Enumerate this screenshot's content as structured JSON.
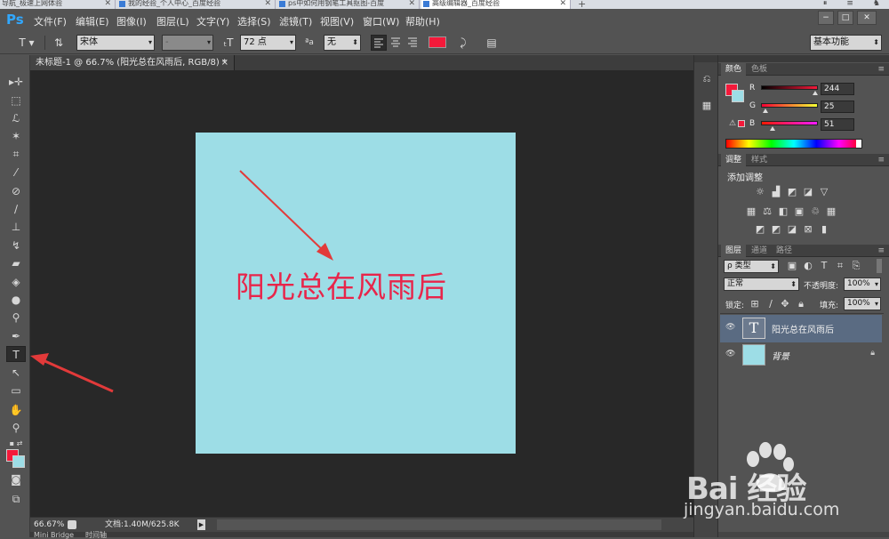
{
  "browser_tabs": [
    {
      "label": "导航_极速上网体验",
      "active": false
    },
    {
      "label": "我的经验_个人中心_百度经验",
      "active": false
    },
    {
      "label": "ps中如何用钢笔工具抠图-百度",
      "active": false
    },
    {
      "label": "高级编辑器_百度经验",
      "active": true
    }
  ],
  "browser_new_tab": "+",
  "app": {
    "logo": "Ps"
  },
  "menu": [
    {
      "label": "文件(F)"
    },
    {
      "label": "编辑(E)"
    },
    {
      "label": "图像(I)"
    },
    {
      "label": "图层(L)"
    },
    {
      "label": "文字(Y)"
    },
    {
      "label": "选择(S)"
    },
    {
      "label": "滤镜(T)"
    },
    {
      "label": "视图(V)"
    },
    {
      "label": "窗口(W)"
    },
    {
      "label": "帮助(H)"
    }
  ],
  "window_controls": {
    "minimize": "−",
    "restore": "□",
    "close": "✕"
  },
  "options": {
    "font_family": "宋体",
    "font_style": "-",
    "font_size": "72 点",
    "antialias": "无",
    "workspace": "基本功能",
    "text_color": "#f4193a"
  },
  "document": {
    "tab_title": "未标题-1 @ 66.7% (阳光总在风雨后, RGB/8) *",
    "canvas_color": "#9ddde6",
    "canvas_text": "阳光总在风雨后",
    "canvas_text_color": "#e8254a"
  },
  "status": {
    "zoom": "66.67%",
    "doc_size": "文档:1.40M/625.8K"
  },
  "bottom_tabs": [
    "Mini Bridge",
    "时间轴"
  ],
  "color_panel": {
    "tabs": [
      "颜色",
      "色板"
    ],
    "r_label": "R",
    "g_label": "G",
    "b_label": "B",
    "r": "244",
    "g": "25",
    "b": "51",
    "fg": "#f4193a",
    "bg": "#9ddde6"
  },
  "adjust_panel": {
    "tabs": [
      "调整",
      "样式"
    ],
    "title": "添加调整"
  },
  "layers_panel": {
    "tabs": [
      "图层",
      "通道",
      "路径"
    ],
    "filter": "ρ 类型",
    "blend_mode": "正常",
    "opacity_label": "不透明度:",
    "opacity": "100%",
    "lock_label": "锁定:",
    "fill_label": "填充:",
    "fill": "100%",
    "layers": [
      {
        "name": "阳光总在风雨后",
        "type": "text",
        "selected": true
      },
      {
        "name": "背景",
        "type": "background",
        "selected": false
      }
    ]
  },
  "watermark": {
    "brand": "Bai 经验",
    "url": "jingyan.baidu.com"
  }
}
